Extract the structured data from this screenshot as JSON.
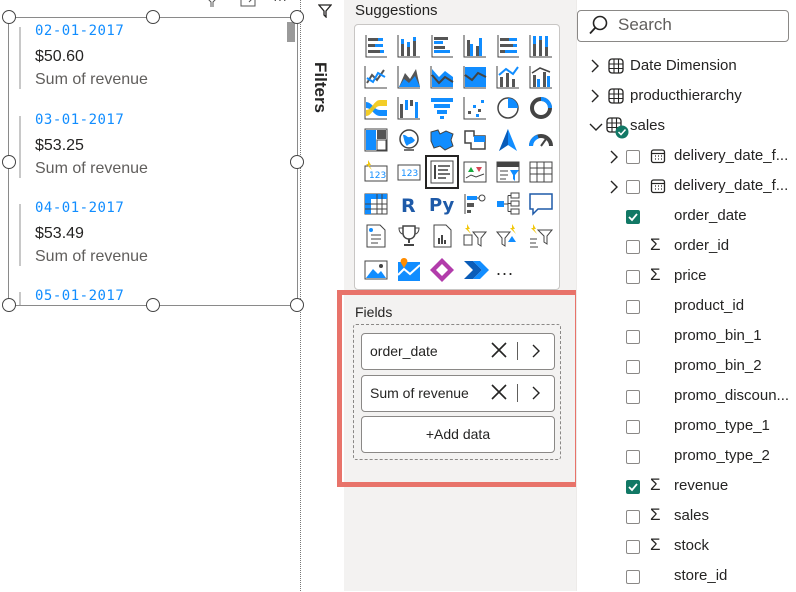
{
  "canvas": {
    "cards": [
      {
        "date": "02-01-2017",
        "value": "$50.60",
        "label": "Sum of revenue"
      },
      {
        "date": "03-01-2017",
        "value": "$53.25",
        "label": "Sum of revenue"
      },
      {
        "date": "04-01-2017",
        "value": "$53.49",
        "label": "Sum of revenue"
      },
      {
        "date": "05-01-2017",
        "value": "",
        "label": ""
      }
    ]
  },
  "filters": {
    "label": "Filters"
  },
  "visualizations": {
    "suggestions_title": "Suggestions",
    "more": "...",
    "fields_title": "Fields",
    "fields": [
      "order_date",
      "Sum of revenue"
    ],
    "add_data": "+Add data"
  },
  "data": {
    "search_placeholder": "Search",
    "tables": [
      {
        "name": "Date Dimension",
        "expanded": false
      },
      {
        "name": "producthierarchy",
        "expanded": false
      },
      {
        "name": "sales",
        "expanded": true
      }
    ],
    "sales_fields": [
      {
        "name": "delivery_date_f...",
        "type": "date-hierarchy",
        "checked": false,
        "expandable": true
      },
      {
        "name": "delivery_date_f...",
        "type": "date-hierarchy",
        "checked": false,
        "expandable": true
      },
      {
        "name": "order_date",
        "type": "text",
        "checked": true,
        "expandable": false
      },
      {
        "name": "order_id",
        "type": "sum",
        "checked": false,
        "expandable": false
      },
      {
        "name": "price",
        "type": "sum",
        "checked": false,
        "expandable": false
      },
      {
        "name": "product_id",
        "type": "text",
        "checked": false,
        "expandable": false
      },
      {
        "name": "promo_bin_1",
        "type": "text",
        "checked": false,
        "expandable": false
      },
      {
        "name": "promo_bin_2",
        "type": "text",
        "checked": false,
        "expandable": false
      },
      {
        "name": "promo_discoun...",
        "type": "text",
        "checked": false,
        "expandable": false
      },
      {
        "name": "promo_type_1",
        "type": "text",
        "checked": false,
        "expandable": false
      },
      {
        "name": "promo_type_2",
        "type": "text",
        "checked": false,
        "expandable": false
      },
      {
        "name": "revenue",
        "type": "sum",
        "checked": true,
        "expandable": false
      },
      {
        "name": "sales",
        "type": "sum",
        "checked": false,
        "expandable": false
      },
      {
        "name": "stock",
        "type": "sum",
        "checked": false,
        "expandable": false
      },
      {
        "name": "store_id",
        "type": "text",
        "checked": false,
        "expandable": false
      }
    ]
  },
  "colors": {
    "accent": "#118dff",
    "highlight_border": "#e8736a",
    "check": "#117865"
  }
}
